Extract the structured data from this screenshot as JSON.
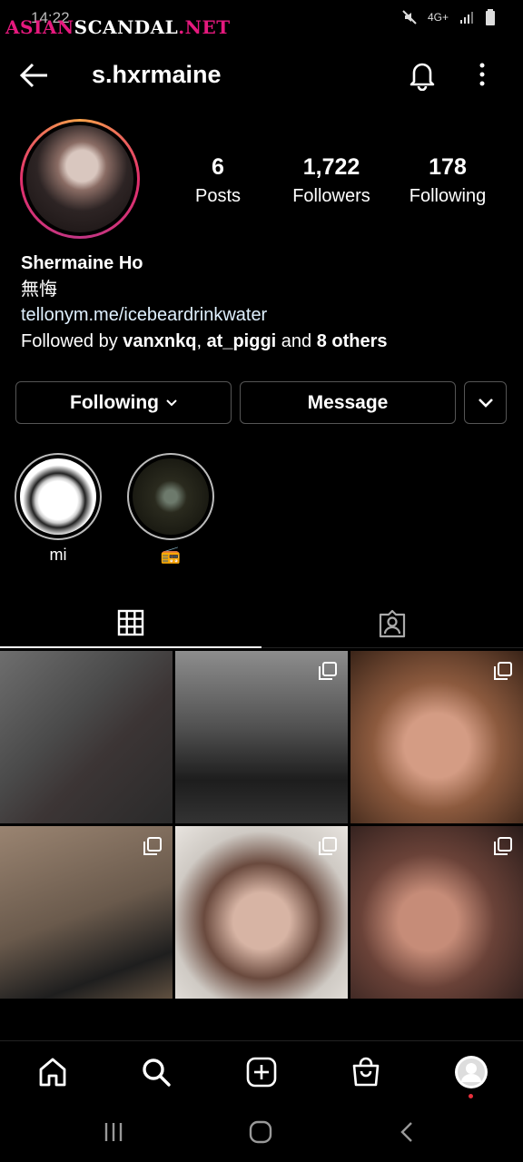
{
  "status_bar": {
    "time": "14:22",
    "network": "4G+",
    "watermark_part1": "ASIAN",
    "watermark_part2": "SCANDAL",
    "watermark_part3": ".NET"
  },
  "header": {
    "username": "s.hxrmaine"
  },
  "stats": {
    "posts_count": "6",
    "posts_label": "Posts",
    "followers_count": "1,722",
    "followers_label": "Followers",
    "following_count": "178",
    "following_label": "Following"
  },
  "bio": {
    "name": "Shermaine Ho",
    "tagline": "無悔",
    "link": "tellonym.me/icebeardrinkwater",
    "followed_by_prefix": "Followed by ",
    "followed_user_1": "vanxnkq",
    "separator": ", ",
    "followed_user_2": "at_piggi",
    "and_text": " and ",
    "others": "8 others"
  },
  "buttons": {
    "following_label": "Following",
    "message_label": "Message"
  },
  "highlights": [
    {
      "label": "mi"
    },
    {
      "label": "📻"
    }
  ],
  "tabs": [
    "posts-grid",
    "tagged"
  ],
  "colors": {
    "background": "#000000",
    "text": "#ffffff",
    "link": "#e0f1ff",
    "border": "#555555",
    "notification_dot": "#e8303c",
    "watermark_pink": "#e6197e"
  }
}
